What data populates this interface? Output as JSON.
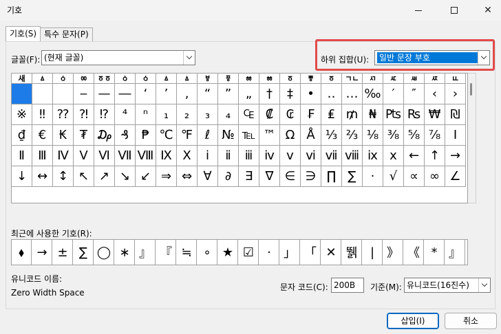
{
  "window": {
    "title": "기호"
  },
  "tabs": [
    "기호(S)",
    "특수 문자(P)"
  ],
  "font": {
    "label": "글꼴(F):",
    "value": "(현재 글꼴)"
  },
  "subset": {
    "label": "하위 집합(U):",
    "value": "일반 문장 부호"
  },
  "grid": {
    "rows": [
      [
        "새",
        "ㅿ",
        "ㆁ",
        "ㆀ",
        "ㆆㆆ",
        "ㆁ",
        "ㆁ",
        "ㅿ",
        "ㅿ",
        "ㅸ",
        "ㆄ",
        "ㆅ",
        "ㆅ",
        "ㆆ",
        "ㅹ",
        "ㆆ",
        "ㄱㄴ",
        "ㅺ",
        "ㅼ",
        "ㅽ",
        "ㅾ",
        "ㅥ"
      ],
      [
        "",
        "",
        "",
        "‒",
        "—",
        "―",
        "‘",
        "’",
        "‚",
        "“",
        "”",
        "„",
        "†",
        "‡",
        "•",
        "‥",
        "…",
        "‰",
        "′",
        "″",
        "‹",
        "›"
      ],
      [
        "※",
        "‼",
        "⁇",
        "⁈",
        "⁉",
        "⁴",
        "ⁿ",
        "₁",
        "₂",
        "₃",
        "₄",
        "₠",
        "₡",
        "₢",
        "₣",
        "₤",
        "₥",
        "₦",
        "₧",
        "₨",
        "₩",
        "₪"
      ],
      [
        "₫",
        "€",
        "₭",
        "₮",
        "₯",
        "₰",
        "₱",
        "℃",
        "℉",
        "ℓ",
        "№",
        "℡",
        "™",
        "Ω",
        "Å",
        "⅓",
        "⅔",
        "⅛",
        "⅜",
        "⅝",
        "⅞",
        "Ⅰ"
      ],
      [
        "Ⅱ",
        "Ⅲ",
        "Ⅳ",
        "Ⅴ",
        "Ⅵ",
        "Ⅶ",
        "Ⅷ",
        "Ⅸ",
        "Ⅹ",
        "ⅰ",
        "ⅱ",
        "ⅲ",
        "ⅳ",
        "ⅴ",
        "ⅵ",
        "ⅶ",
        "ⅷ",
        "ⅸ",
        "ⅹ",
        "←",
        "↑",
        "→"
      ],
      [
        "↓",
        "↔",
        "↕",
        "↖",
        "↗",
        "↘",
        "↙",
        "⇒",
        "⇔",
        "∀",
        "∂",
        "∃",
        "∇",
        "∈",
        "∋",
        "∏",
        "∑",
        "·",
        "√",
        "∝",
        "∞",
        "∠"
      ]
    ]
  },
  "recent": {
    "label": "최근에 사용한 기호(R):",
    "items": [
      "⬧",
      "→",
      "±",
      "∑",
      "◯",
      "∗",
      "』",
      "『",
      "≒",
      "∘",
      "★",
      "☑",
      "·",
      "」",
      "「",
      "✕",
      "뛝",
      "|",
      "》",
      "《",
      "*",
      "』"
    ]
  },
  "unicode_name": {
    "label": "유니코드 이름:",
    "value": "Zero Width Space"
  },
  "char_code": {
    "label": "문자 코드(C):",
    "value": "200B"
  },
  "base": {
    "label": "기준(M):",
    "value": "유니코드(16진수)"
  },
  "buttons": {
    "insert": "삽입(I)",
    "cancel": "취소"
  }
}
